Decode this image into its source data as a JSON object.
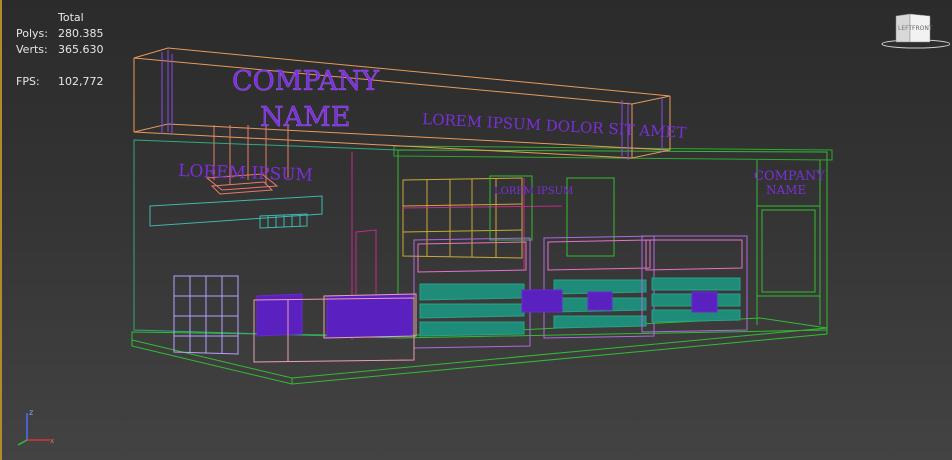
{
  "stats": {
    "total_label": "Total",
    "polys_label": "Polys:",
    "polys_value": "280.385",
    "verts_label": "Verts:",
    "verts_value": "365.630",
    "fps_label": "FPS:",
    "fps_value": "102,772"
  },
  "scene": {
    "company_line1": "COMPANY",
    "company_line2": "NAME",
    "header_text": "LOREM IPSUM DOLOR SIT AMET",
    "left_wall_text": "LOREM IPSUM",
    "window_text": "LOREM IPSUM",
    "side_company_line1": "COMPANY",
    "side_company_line2": "NAME"
  },
  "viewcube": {
    "left_face": "LEFT",
    "front_face": "FRONT"
  },
  "axis": {
    "z_label": "z",
    "x_label": "x"
  },
  "colors": {
    "purple": "#7b2fd8",
    "green": "#33bb33",
    "orange": "#e89a5a",
    "teal": "#2aa08a",
    "yellow": "#c9a93a",
    "magenta": "#c22a8a",
    "cyan": "#3fb7b0",
    "pink": "#e87aa0"
  }
}
